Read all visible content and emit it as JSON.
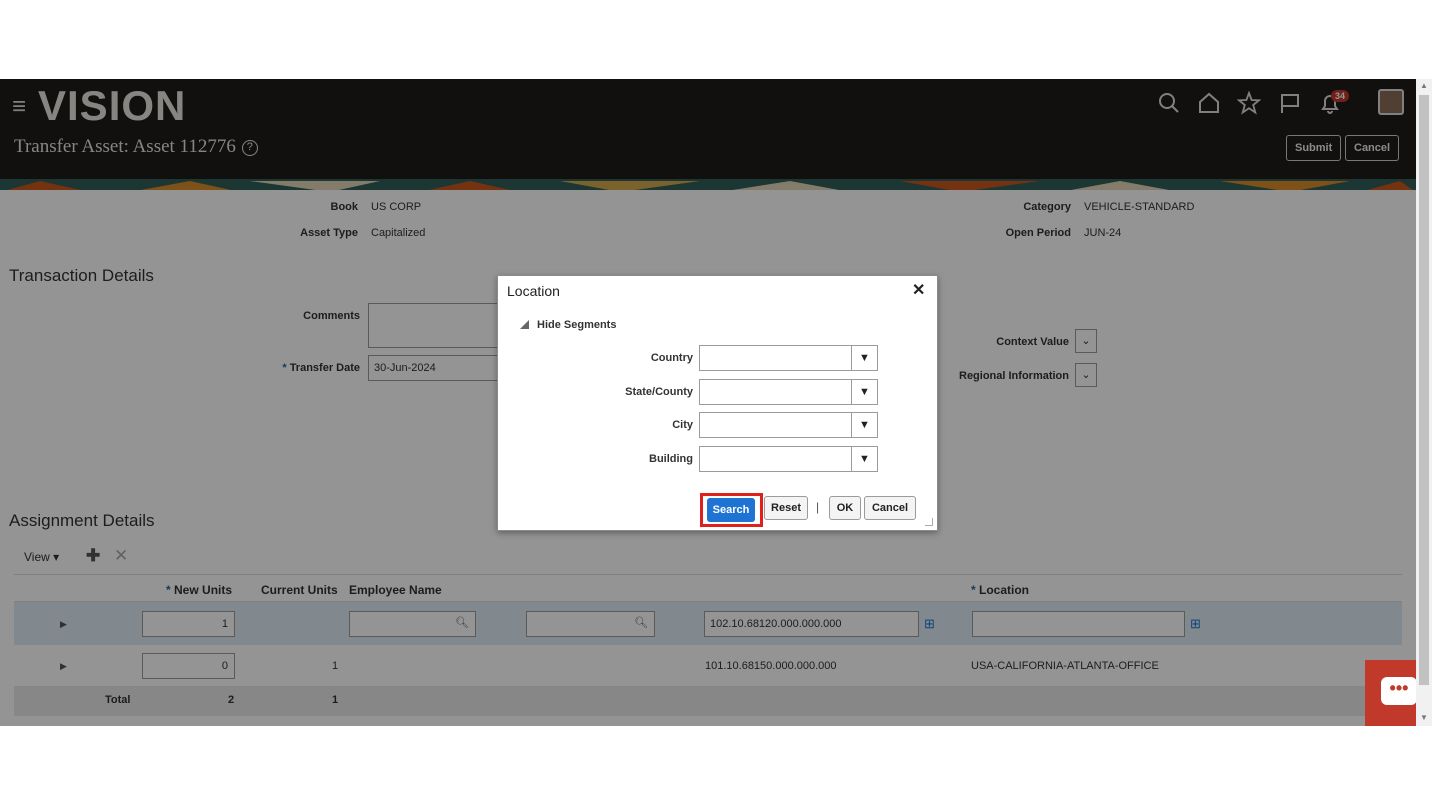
{
  "header": {
    "logo": "VISION",
    "title": "Transfer Asset: Asset 112776",
    "help_glyph": "?",
    "notification_count": "34",
    "submit_label": "Submit",
    "cancel_label": "Cancel",
    "icons": [
      "hamburger-icon",
      "search-icon",
      "home-icon",
      "star-icon",
      "flag-icon",
      "bell-icon",
      "avatar"
    ]
  },
  "asset_info": {
    "book_label": "Book",
    "book_value": "US CORP",
    "asset_type_label": "Asset Type",
    "asset_type_value": "Capitalized",
    "category_label": "Category",
    "category_value": "VEHICLE-STANDARD",
    "open_period_label": "Open Period",
    "open_period_value": "JUN-24"
  },
  "transaction": {
    "section_title": "Transaction Details",
    "comments_label": "Comments",
    "comments_value": "",
    "transfer_date_label": "Transfer Date",
    "transfer_date_value": "30-Jun-2024",
    "context_value_label": "Context Value",
    "regional_info_label": "Regional Information"
  },
  "assignment": {
    "section_title": "Assignment Details",
    "view_label": "View",
    "columns": {
      "new_units": "New Units",
      "current_units": "Current Units",
      "employee_name": "Employee Name",
      "location": "Location"
    },
    "rows": [
      {
        "new_units": "1",
        "current_units": "",
        "employee_name": "",
        "expense_account": "102.10.68120.000.000.000",
        "location": ""
      },
      {
        "new_units": "0",
        "current_units": "1",
        "employee_name": "",
        "expense_account": "101.10.68150.000.000.000",
        "location": "USA-CALIFORNIA-ATLANTA-OFFICE"
      }
    ],
    "total": {
      "label": "Total",
      "new_units": "2",
      "current_units": "1"
    }
  },
  "dialog": {
    "title": "Location",
    "close_glyph": "✕",
    "hide_segments": "Hide Segments",
    "fields": [
      {
        "label": "Country",
        "value": ""
      },
      {
        "label": "State/County",
        "value": ""
      },
      {
        "label": "City",
        "value": ""
      },
      {
        "label": "Building",
        "value": ""
      }
    ],
    "search_label": "Search",
    "reset_label": "Reset",
    "separator": "|",
    "ok_label": "OK",
    "cancel_label": "Cancel"
  },
  "colors": {
    "header_bg": "#1f1d1b",
    "primary_button": "#1f74d3",
    "highlight": "#e0201b",
    "chat": "#c0392b"
  }
}
